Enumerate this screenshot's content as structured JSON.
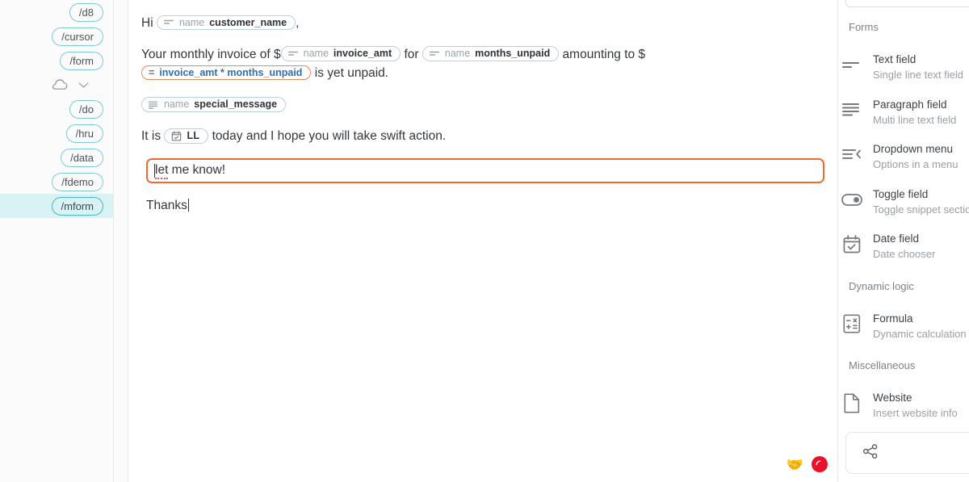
{
  "sidebar": {
    "snippets_top": [
      {
        "label": "/d8",
        "selected": false
      },
      {
        "label": "/cursor",
        "selected": false
      },
      {
        "label": "/form",
        "selected": false
      }
    ],
    "folder_row": {
      "cloud_icon": "cloud-icon",
      "chevron_icon": "chevron-down-icon"
    },
    "snippets_bottom": [
      {
        "label": "/do",
        "selected": false
      },
      {
        "label": "/hru",
        "selected": false
      },
      {
        "label": "/data",
        "selected": false
      },
      {
        "label": "/fdemo",
        "selected": false
      },
      {
        "label": "/mform",
        "selected": true
      }
    ]
  },
  "editor": {
    "greeting_prefix": "Hi",
    "greeting_suffix": ",",
    "token_customer_name": {
      "kind": "name",
      "value": "customer_name",
      "icon": "text-field-icon"
    },
    "invoice_prefix": "Your monthly invoice of $",
    "token_invoice_amt": {
      "kind": "name",
      "value": "invoice_amt",
      "icon": "text-field-icon"
    },
    "invoice_mid": "for",
    "token_months_unpaid": {
      "kind": "name",
      "value": "months_unpaid",
      "icon": "text-field-icon"
    },
    "invoice_amounting": "amounting to $",
    "token_formula": {
      "kind": "=",
      "value": "invoice_amt * months_unpaid",
      "icon": "equals-icon"
    },
    "invoice_tail": "is yet unpaid.",
    "token_special_message": {
      "kind": "name",
      "value": "special_message",
      "icon": "paragraph-field-icon"
    },
    "date_prefix": "It is",
    "token_date": {
      "value": "LL",
      "icon": "calendar-icon"
    },
    "date_suffix": "today and I hope you will take swift action.",
    "active_line_text": "let me know!",
    "closing_text": "Thanks",
    "badges": {
      "handshake": "🤝",
      "record": "record-icon"
    },
    "accent_focus_color": "#ef6a31"
  },
  "right_panel": {
    "search_placeholder": "",
    "sections": [
      {
        "title": "Forms",
        "items": [
          {
            "name": "Text field",
            "desc": "Single line text field",
            "icon": "text-field-icon"
          },
          {
            "name": "Paragraph field",
            "desc": "Multi line text field",
            "icon": "paragraph-field-icon"
          },
          {
            "name": "Dropdown menu",
            "desc": "Options in a menu",
            "icon": "dropdown-menu-icon"
          },
          {
            "name": "Toggle field",
            "desc": "Toggle snippet section",
            "icon": "toggle-icon"
          },
          {
            "name": "Date field",
            "desc": "Date chooser",
            "icon": "calendar-icon"
          }
        ]
      },
      {
        "title": "Dynamic logic",
        "items": [
          {
            "name": "Formula",
            "desc": "Dynamic calculation",
            "icon": "calculator-icon"
          }
        ]
      },
      {
        "title": "Miscellaneous",
        "items": [
          {
            "name": "Website",
            "desc": "Insert website info",
            "icon": "page-icon"
          }
        ]
      }
    ],
    "share": {
      "icon": "share-icon"
    }
  }
}
